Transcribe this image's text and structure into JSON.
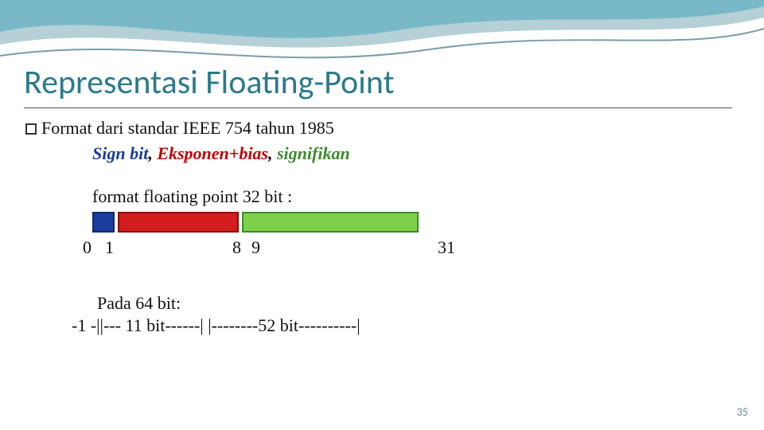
{
  "slide": {
    "title": "Representasi Floating-Point",
    "page_number": "35"
  },
  "bullet": {
    "text": "Format dari standar IEEE  754 tahun 1985"
  },
  "fields": {
    "sign": "Sign bit",
    "exp": "Eksponen+bias",
    "sig": "signifikan"
  },
  "format32": {
    "label": "format floating  point 32 bit :",
    "indices": {
      "start": "0",
      "exp_start": "1",
      "exp_end": "8",
      "sig_start": "9",
      "end": "31"
    }
  },
  "format64": {
    "heading": "Pada 64 bit:",
    "line": "-1 -||--- 11 bit------|  |--------52 bit----------|"
  },
  "colors": {
    "accent": "#2b7a8c",
    "sign": "#1a3e9c",
    "exp": "#d21e1e",
    "sig": "#7fd04a"
  }
}
